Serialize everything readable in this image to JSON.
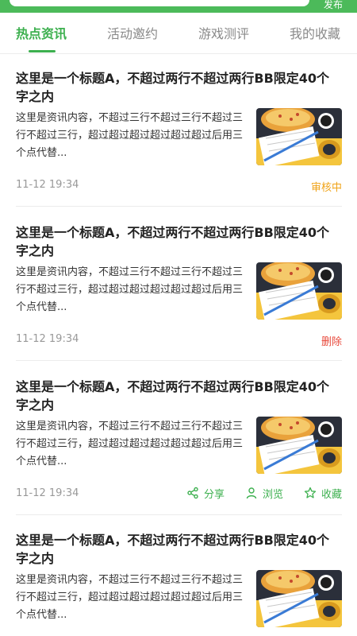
{
  "header": {
    "publish_label": "发布",
    "accent": "#3db04f"
  },
  "tabs": [
    {
      "label": "热点资讯",
      "active": true
    },
    {
      "label": "活动邀约",
      "active": false
    },
    {
      "label": "游戏测评",
      "active": false
    },
    {
      "label": "我的收藏",
      "active": false
    }
  ],
  "cards": [
    {
      "title": "这里是一个标题A，不超过两行不超过两行BB限定40个字之内",
      "body": "这里是资讯内容，不超过三行不超过三行不超过三行不超过三行，超过超过超过超过超过超过后用三个点代替...",
      "time": "11-12 19:34",
      "status": "审核中",
      "status_color": "#f0a318"
    },
    {
      "title": "这里是一个标题A，不超过两行不超过两行BB限定40个字之内",
      "body": "这里是资讯内容，不超过三行不超过三行不超过三行不超过三行，超过超过超过超过超过超过后用三个点代替...",
      "time": "11-12 19:34",
      "status": "删除",
      "status_color": "#e84a3c"
    },
    {
      "title": "这里是一个标题A，不超过两行不超过两行BB限定40个字之内",
      "body": "这里是资讯内容，不超过三行不超过三行不超过三行不超过三行，超过超过超过超过超过超过后用三个点代替...",
      "time": "11-12 19:34",
      "actions": {
        "share": "分享",
        "browse": "浏览",
        "favorite": "收藏"
      }
    },
    {
      "title": "这里是一个标题A，不超过两行不超过两行BB限定40个字之内",
      "body": "这里是资讯内容，不超过三行不超过三行不超过三行不超过三行，超过超过超过超过超过超过后用三个点代替..."
    }
  ]
}
